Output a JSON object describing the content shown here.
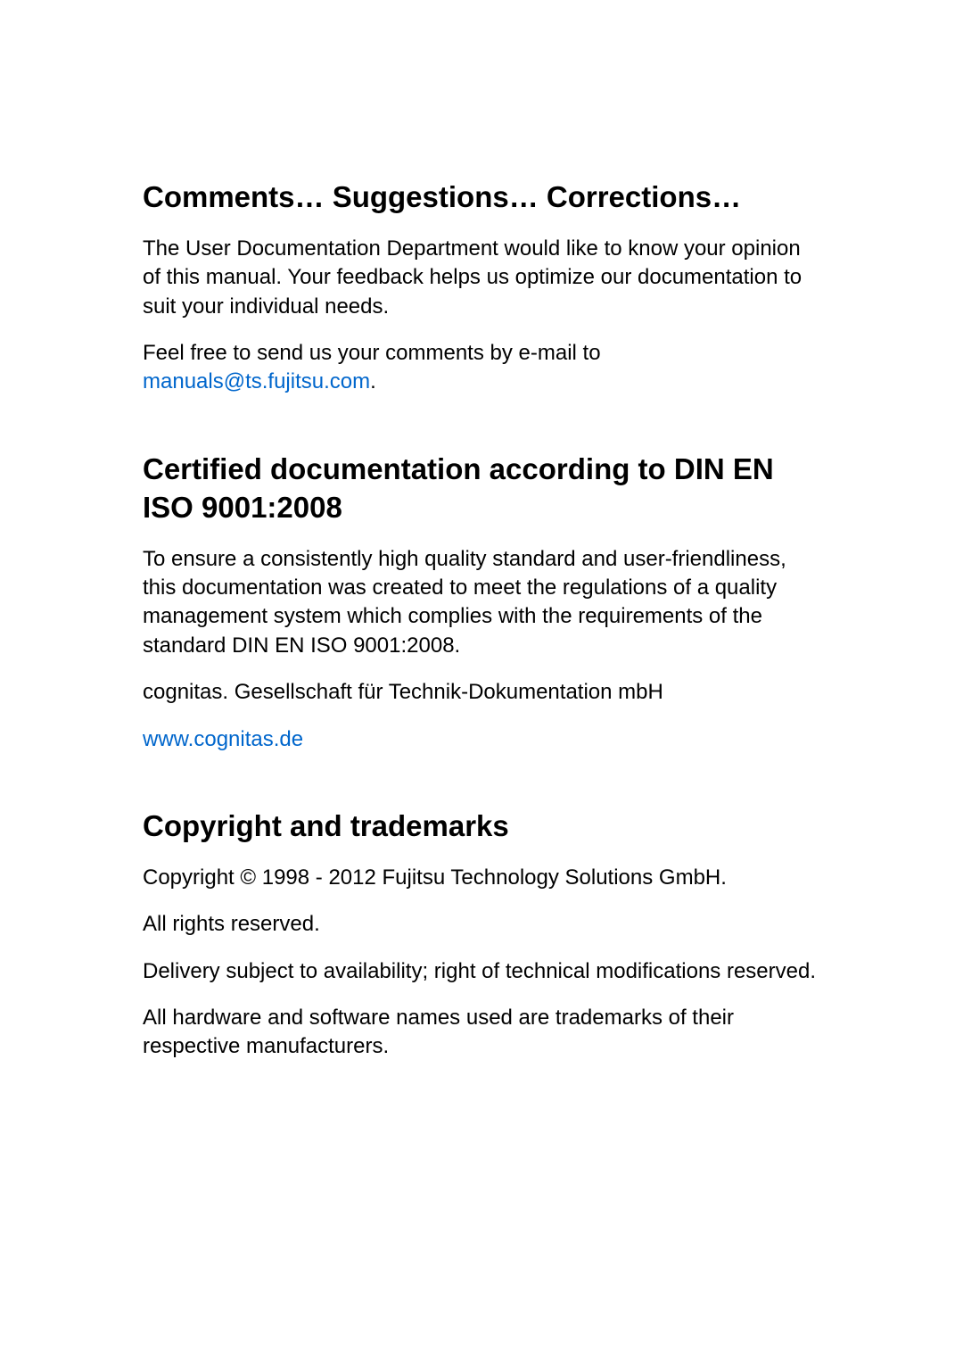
{
  "sections": {
    "comments": {
      "heading": "Comments… Suggestions… Corrections…",
      "para1": "The User Documentation Department would like to know your opinion of this manual. Your feedback helps us optimize our documentation to suit your individual needs.",
      "para2_prefix": "Feel free to send us your comments by e-mail to ",
      "email": "manuals@ts.fujitsu.com",
      "para2_suffix": "."
    },
    "certified": {
      "heading": "Certified documentation according to DIN EN ISO 9001:2008",
      "para1": "To ensure a consistently high quality standard and user-friendliness, this documentation was created to meet the regulations of a quality management system which complies with the requirements of the standard DIN EN ISO 9001:2008.",
      "para2": "cognitas. Gesellschaft für Technik-Dokumentation mbH",
      "link": "www.cognitas.de"
    },
    "copyright": {
      "heading": "Copyright and trademarks",
      "para1": "Copyright © 1998 - 2012  Fujitsu Technology Solutions GmbH.",
      "para2": "All rights reserved.",
      "para3": "Delivery subject to availability; right of technical modifications reserved.",
      "para4": "All hardware and software names used are trademarks of their respective manufacturers."
    }
  }
}
